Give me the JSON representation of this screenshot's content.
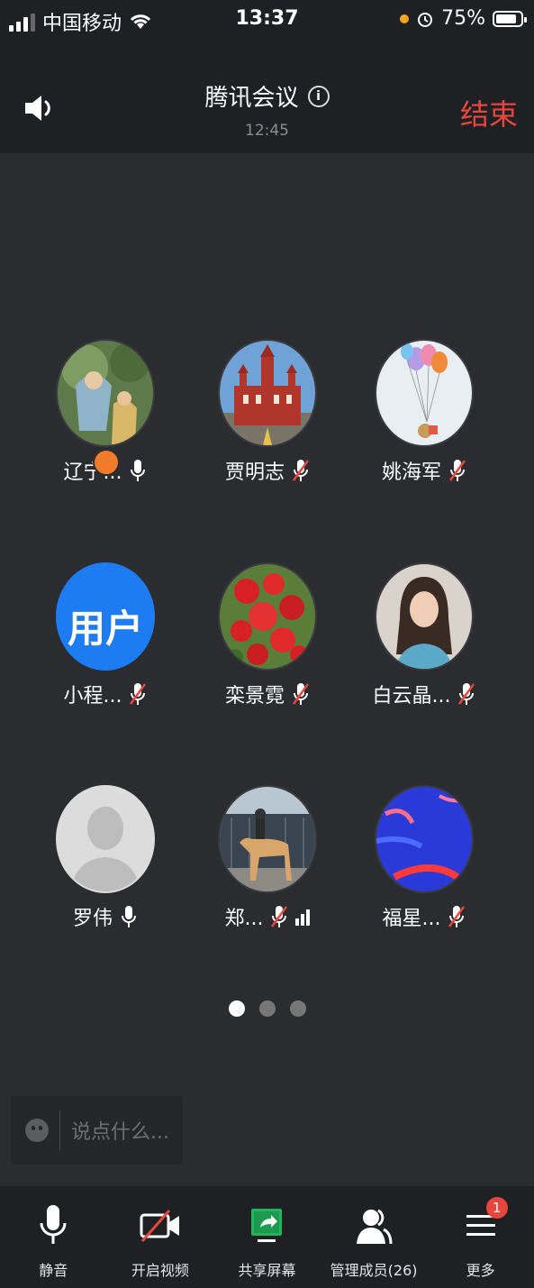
{
  "status_bar": {
    "carrier": "中国移动",
    "time": "13:37",
    "battery": "75%"
  },
  "header": {
    "title": "腾讯会议",
    "duration": "12:45",
    "end_label": "结束"
  },
  "participants": [
    {
      "name": "辽宁...",
      "mic": "on",
      "avatar": "painting",
      "host": true
    },
    {
      "name": "贾明志",
      "mic": "muted",
      "avatar": "building"
    },
    {
      "name": "姚海军",
      "mic": "muted",
      "avatar": "balloons"
    },
    {
      "name": "小程...",
      "mic": "muted",
      "avatar": "text",
      "avatar_text": "用户"
    },
    {
      "name": "栾景霓",
      "mic": "muted",
      "avatar": "flowers"
    },
    {
      "name": "白云晶...",
      "mic": "muted",
      "avatar": "woman"
    },
    {
      "name": "罗伟",
      "mic": "on",
      "avatar": "default"
    },
    {
      "name": "郑...",
      "mic": "muted",
      "avatar": "horse",
      "signal": true
    },
    {
      "name": "福星...",
      "mic": "muted",
      "avatar": "blue"
    }
  ],
  "pagination": {
    "pages": 3,
    "current": 1
  },
  "chat": {
    "placeholder": "说点什么..."
  },
  "toolbar": {
    "mute_label": "静音",
    "video_label": "开启视频",
    "share_label": "共享屏幕",
    "members_label": "管理成员(26)",
    "more_label": "更多",
    "more_badge": "1"
  },
  "colors": {
    "end": "#e8453c",
    "host_badge": "#f07c2b",
    "blue_avatar": "#1d7cf2",
    "share_green": "#22b35e"
  }
}
